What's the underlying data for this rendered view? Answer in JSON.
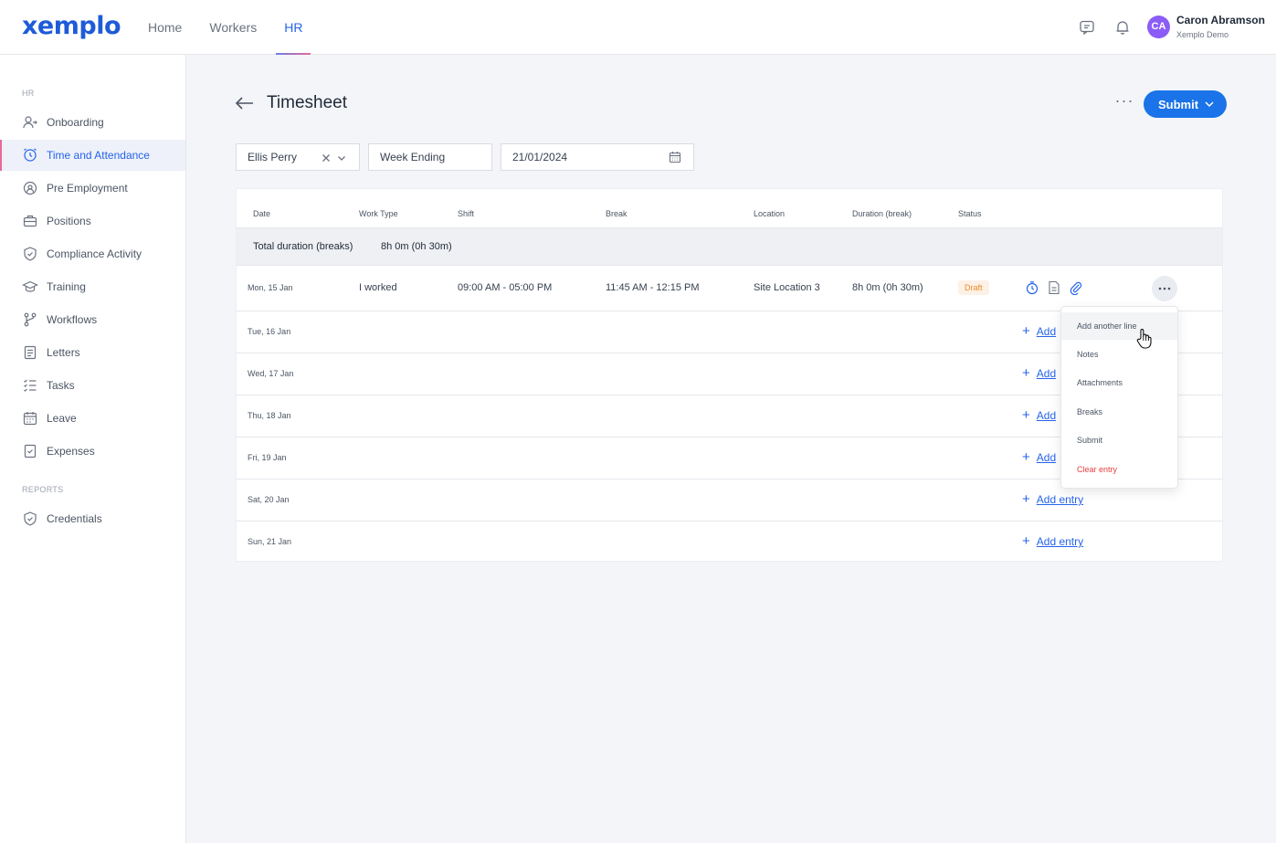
{
  "app": {
    "logo": "xemplo",
    "nav": [
      "Home",
      "Workers",
      "HR"
    ],
    "active_nav": "HR",
    "user": {
      "initials": "CA",
      "name": "Caron Abramson",
      "org": "Xemplo Demo"
    }
  },
  "sidebar": {
    "section_hr": "HR",
    "section_reports": "REPORTS",
    "items": [
      {
        "label": "Onboarding",
        "icon": "user-add-icon"
      },
      {
        "label": "Time and Attendance",
        "icon": "clock-icon"
      },
      {
        "label": "Pre Employment",
        "icon": "id-badge-icon"
      },
      {
        "label": "Positions",
        "icon": "briefcase-icon"
      },
      {
        "label": "Compliance Activity",
        "icon": "shield-check-icon"
      },
      {
        "label": "Training",
        "icon": "graduation-cap-icon"
      },
      {
        "label": "Workflows",
        "icon": "workflow-icon"
      },
      {
        "label": "Letters",
        "icon": "letter-icon"
      },
      {
        "label": "Tasks",
        "icon": "task-list-icon"
      },
      {
        "label": "Leave",
        "icon": "calendar-icon"
      },
      {
        "label": "Expenses",
        "icon": "receipt-icon"
      }
    ],
    "report_items": [
      {
        "label": "Credentials",
        "icon": "shield-check-icon"
      }
    ]
  },
  "page": {
    "title": "Timesheet",
    "more": "···",
    "submit": "Submit"
  },
  "filters": {
    "worker": "Ellis Perry",
    "period_type": "Week Ending",
    "date": "21/01/2024"
  },
  "table": {
    "headers": [
      "Date",
      "Work Type",
      "Shift",
      "Break",
      "Location",
      "Duration (break)",
      "Status"
    ],
    "total_label": "Total duration (breaks)",
    "total_value": "8h 0m (0h 30m)",
    "entry": {
      "date": "Mon, 15 Jan",
      "work_type": "I worked",
      "shift": "09:00 AM - 05:00 PM",
      "break": "11:45 AM - 12:15 PM",
      "location": "Site Location 3",
      "duration": "8h 0m (0h 30m)",
      "status": "Draft"
    },
    "empty_days": [
      "Tue, 16 Jan",
      "Wed, 17 Jan",
      "Thu, 18 Jan",
      "Fri, 19 Jan",
      "Sat, 20 Jan",
      "Sun, 21 Jan"
    ],
    "add_label_short": "Add",
    "add_label": "Add entry"
  },
  "menu": {
    "items": [
      "Add another line",
      "Notes",
      "Attachments",
      "Breaks",
      "Submit",
      "Clear entry"
    ]
  },
  "colors": {
    "primary": "#1a73e8",
    "accent": "#e56a98",
    "draft": "#ea8a2a",
    "danger": "#e53e3e"
  }
}
